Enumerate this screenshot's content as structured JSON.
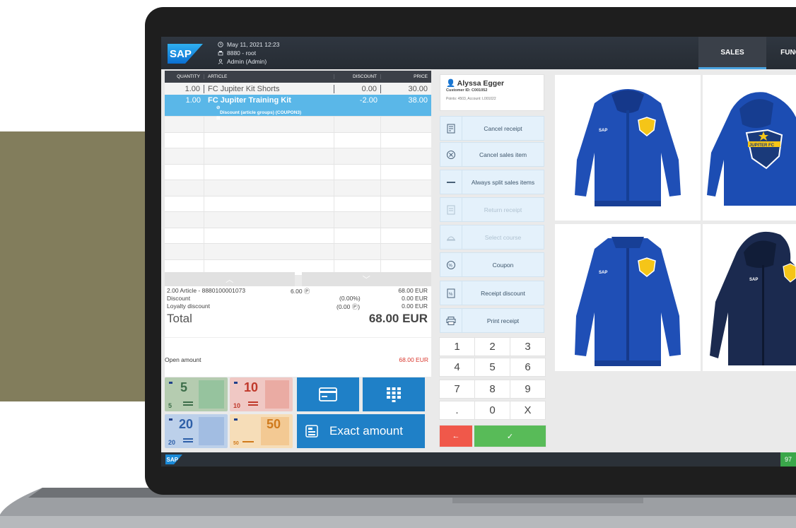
{
  "header": {
    "datetime": "May 11, 2021 12:23",
    "terminal": "8880 - root",
    "user": "Admin (Admin)",
    "tabs": [
      "SALES",
      "FUNC"
    ]
  },
  "receipt": {
    "columns": [
      "QUANTITY",
      "ARTICLE",
      "DISCOUNT",
      "PRICE"
    ],
    "items": [
      {
        "qty": "1.00",
        "article": "FC Jupiter Kit Shorts",
        "discount": "0.00",
        "price": "30.00",
        "note": ""
      },
      {
        "qty": "1.00",
        "article": "FC Jupiter Training Kit",
        "discount": "-2.00",
        "price": "38.00",
        "note": "Discount (article groups) (COUPON3)"
      }
    ]
  },
  "summary": {
    "articles_label": "2.00 Article - 8880100001073",
    "articles_points": "6.00 Ⓟ",
    "articles_value": "68.00 EUR",
    "discount_label": "Discount",
    "discount_pct": "(0.00%)",
    "discount_value": "0.00 EUR",
    "loyalty_label": "Loyalty discount",
    "loyalty_pts": "(0.00 Ⓟ)",
    "loyalty_value": "0.00 EUR",
    "total_label": "Total",
    "total_value": "68.00 EUR",
    "open_label": "Open amount",
    "open_value": "68.00 EUR"
  },
  "tender": {
    "notes": [
      "5",
      "10",
      "20",
      "50"
    ],
    "exact_label": "Exact amount"
  },
  "customer": {
    "name": "Alyssa Egger",
    "customer_id": "Customer ID: C001052",
    "points": "Points: 4503, Account: L001022"
  },
  "functions": [
    {
      "label": "Cancel receipt",
      "icon": "receipt-cancel-icon",
      "enabled": true
    },
    {
      "label": "Cancel sales item",
      "icon": "cancel-item-icon",
      "enabled": true
    },
    {
      "label": "Always split sales items",
      "icon": "split-icon",
      "enabled": true
    },
    {
      "label": "Return receipt",
      "icon": "return-icon",
      "enabled": false
    },
    {
      "label": "Select course",
      "icon": "course-icon",
      "enabled": false
    },
    {
      "label": "Coupon",
      "icon": "coupon-icon",
      "enabled": true
    },
    {
      "label": "Receipt discount",
      "icon": "discount-icon",
      "enabled": true
    },
    {
      "label": "Print receipt",
      "icon": "printer-icon",
      "enabled": true
    }
  ],
  "numpad": [
    "1",
    "2",
    "3",
    "4",
    "5",
    "6",
    "7",
    "8",
    "9",
    ".",
    "0",
    "X",
    "←",
    "✓"
  ],
  "status": {
    "badge": "97"
  },
  "colors": {
    "accent": "#1f80c7",
    "selected_row": "#5ab7e8",
    "open_amount": "#d9372d",
    "ok": "#58bb58",
    "back": "#f0584a"
  }
}
